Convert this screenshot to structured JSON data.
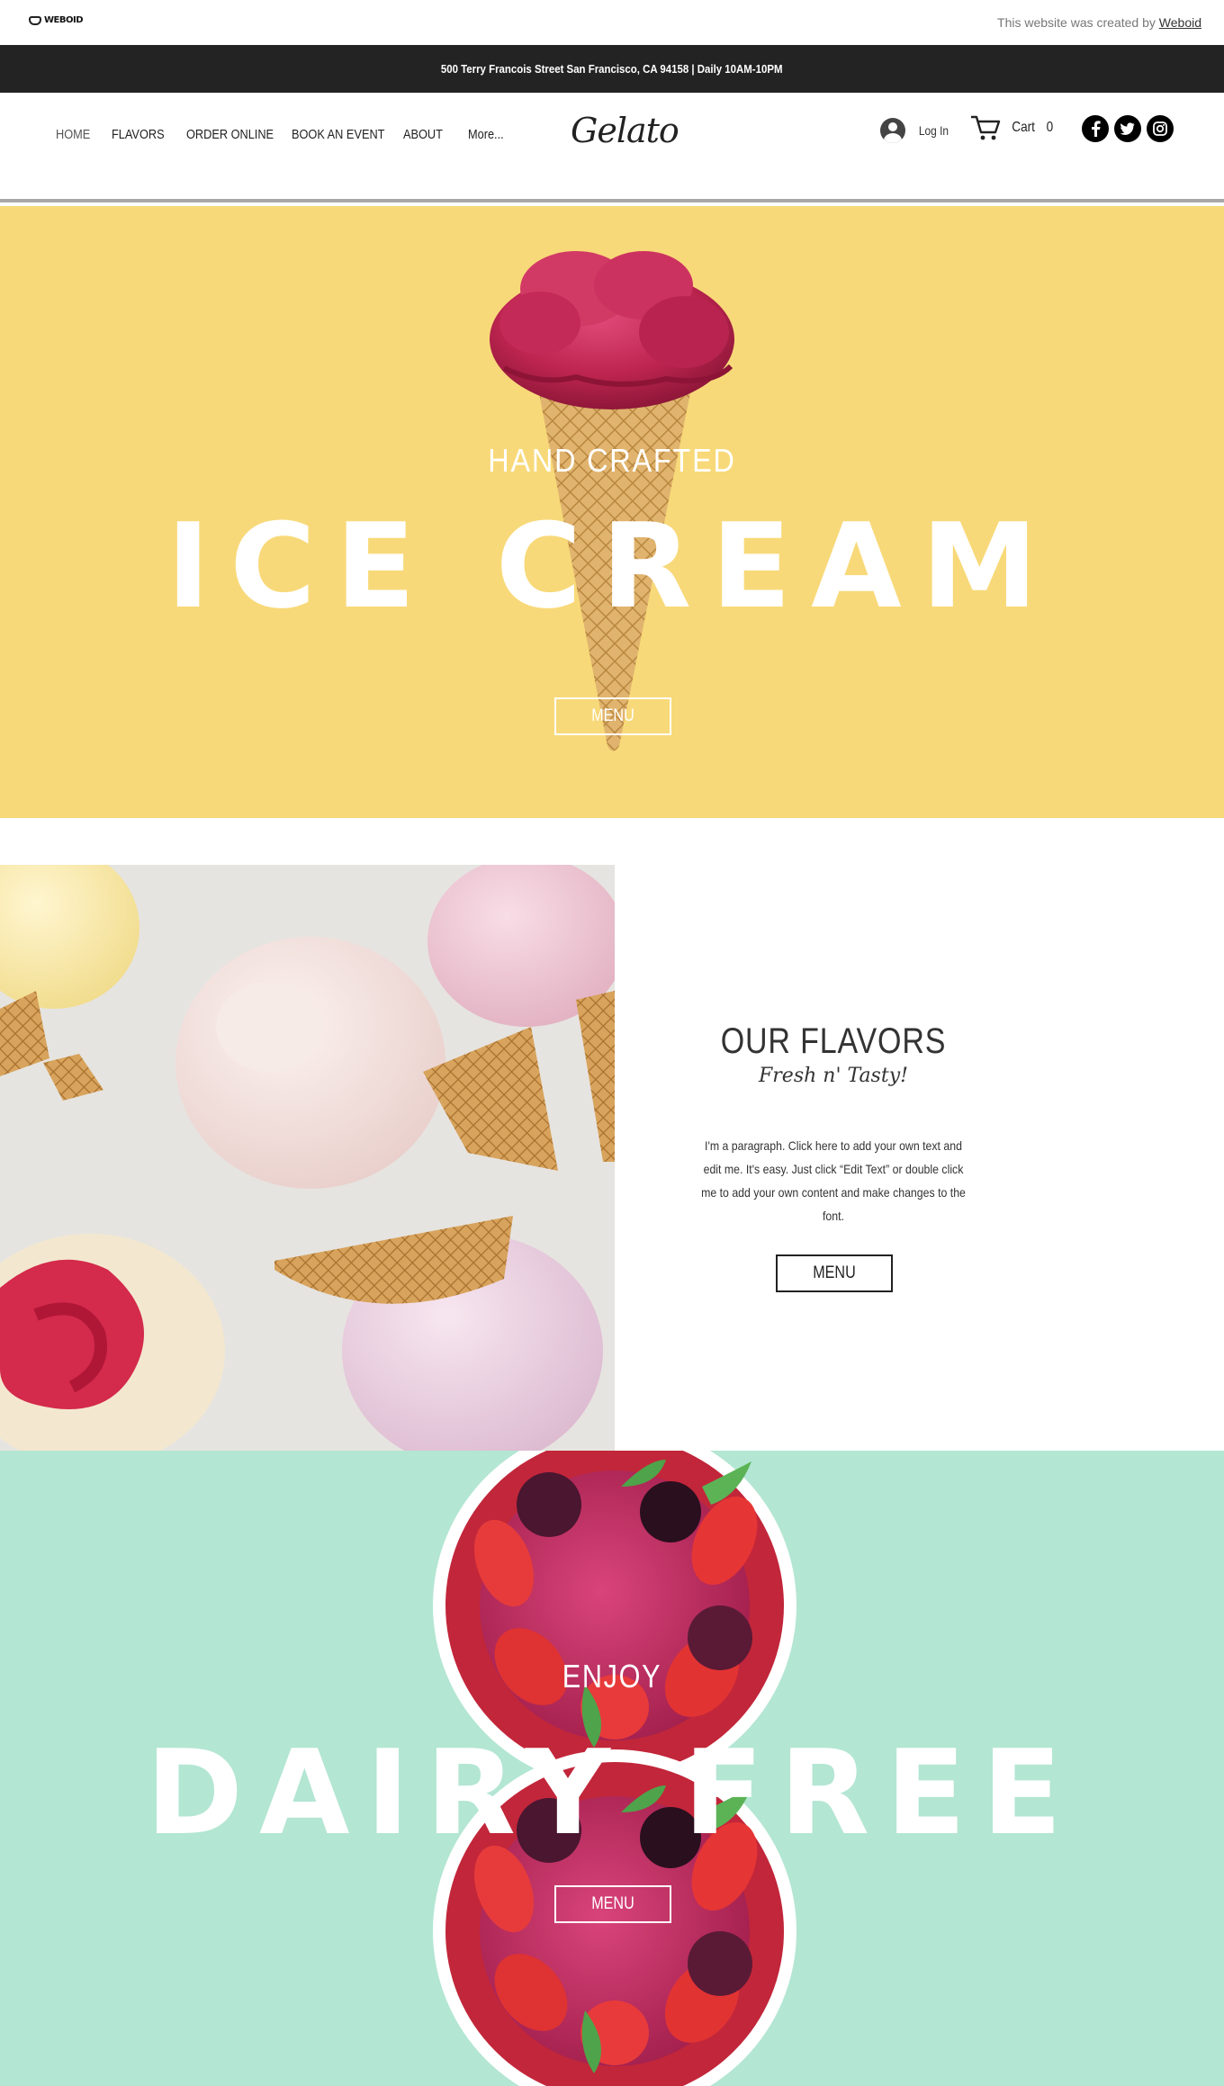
{
  "topbar": {
    "brand": "WEBOID",
    "credit_text": "This website was created by",
    "credit_link": "Weboid"
  },
  "address_bar": {
    "text": "500 Terry Francois Street San Francisco, CA 94158  |  Daily 10AM-10PM"
  },
  "header": {
    "nav": [
      {
        "label": "HOME",
        "active": true
      },
      {
        "label": "FLAVORS"
      },
      {
        "label": "ORDER ONLINE"
      },
      {
        "label": "BOOK AN EVENT"
      },
      {
        "label": "ABOUT"
      },
      {
        "label": "More..."
      }
    ],
    "logo": "Gelato",
    "login_label": "Log In",
    "cart_label": "Cart",
    "cart_count": "0",
    "social_icons": [
      "facebook-icon",
      "twitter-icon",
      "instagram-icon"
    ]
  },
  "hero": {
    "kicker": "HAND CRAFTED",
    "title": "ICE CREAM",
    "button": "MENU",
    "bg_color": "#f8d979"
  },
  "flavors": {
    "title": "OUR FLAVORS",
    "subtitle": "Fresh n' Tasty!",
    "paragraph": "I'm a paragraph. Click here to add your own text and edit me. It's easy. Just click “Edit Text” or double click me to add your own content and make changes to the font.",
    "button": "MENU"
  },
  "dairy": {
    "kicker": "ENJOY",
    "title": "DAIRY FREE",
    "button": "MENU",
    "bg_color": "#b3e6d3"
  }
}
